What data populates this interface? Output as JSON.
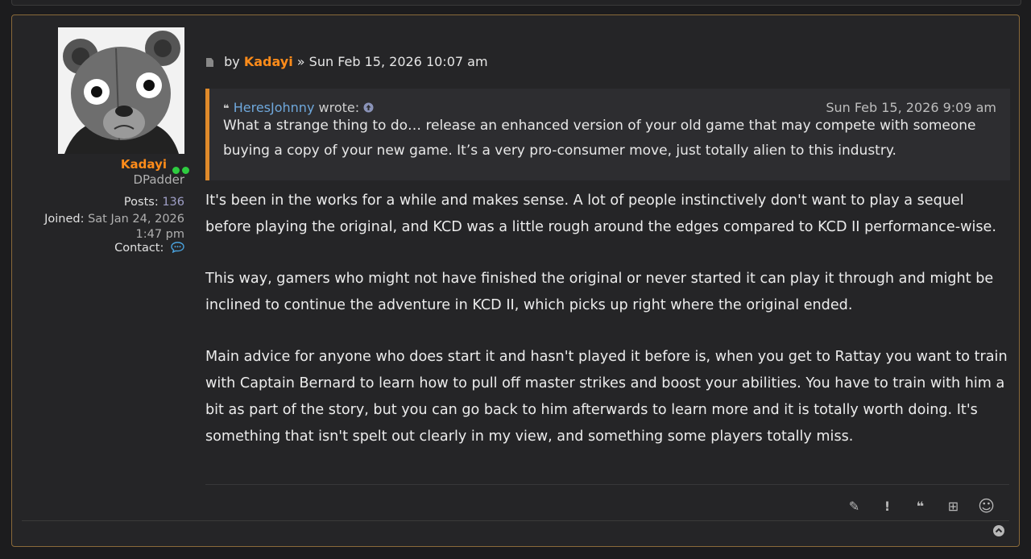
{
  "profile": {
    "username": "Kadayi",
    "rank": "DPadder",
    "posts_label": "Posts:",
    "posts_value": "136",
    "joined_label": "Joined:",
    "joined_value": "Sat Jan 24, 2026 1:47 pm",
    "contact_label": "Contact:",
    "online_color": "#2ecc40",
    "username_color": "#ff8c1a"
  },
  "post": {
    "by_label": "by",
    "author": "Kadayi",
    "separator": "»",
    "timestamp": "Sun Feb 15, 2026 10:07 am"
  },
  "quote": {
    "author": "HeresJohnny",
    "wrote_label": "wrote:",
    "timestamp": "Sun Feb 15, 2026 9:09 am",
    "text": "What a strange thing to do… release an enhanced version of your old game that may compete with someone buying a copy of your new game. It’s a very pro-consumer move, just totally alien to this industry."
  },
  "body": {
    "paragraphs": [
      "It's been in the works for a while and makes sense. A lot of people instinctively don't want to play a sequel before playing the original, and KCD was a little rough around the edges compared to KCD II performance-wise.",
      "This way, gamers who might not have finished the original or never started it can play it through and might be inclined to continue the adventure in KCD II, which picks up right where the original ended.",
      "Main advice for anyone who does start it and hasn't played it before is, when you get to Rattay you want to train with Captain Bernard to learn how to pull off master strikes and boost your abilities. You have to train with him a bit as part of the story, but you can go back to him afterwards to learn more and it is totally worth doing. It's something that isn't spelt out clearly in my view, and something some players totally miss."
    ]
  },
  "actions": [
    {
      "icon": "pencil-icon",
      "glyph": "✎"
    },
    {
      "icon": "report-icon",
      "glyph": "!"
    },
    {
      "icon": "quote-icon",
      "glyph": "❝"
    },
    {
      "icon": "plus-box-icon",
      "glyph": "⊞"
    },
    {
      "icon": "smiley-icon",
      "glyph": "☺"
    }
  ],
  "colors": {
    "accent": "#ff8c1a",
    "quote_border": "#e08a2a",
    "link": "#6fa8dc",
    "post_border": "#8a6a3a"
  }
}
